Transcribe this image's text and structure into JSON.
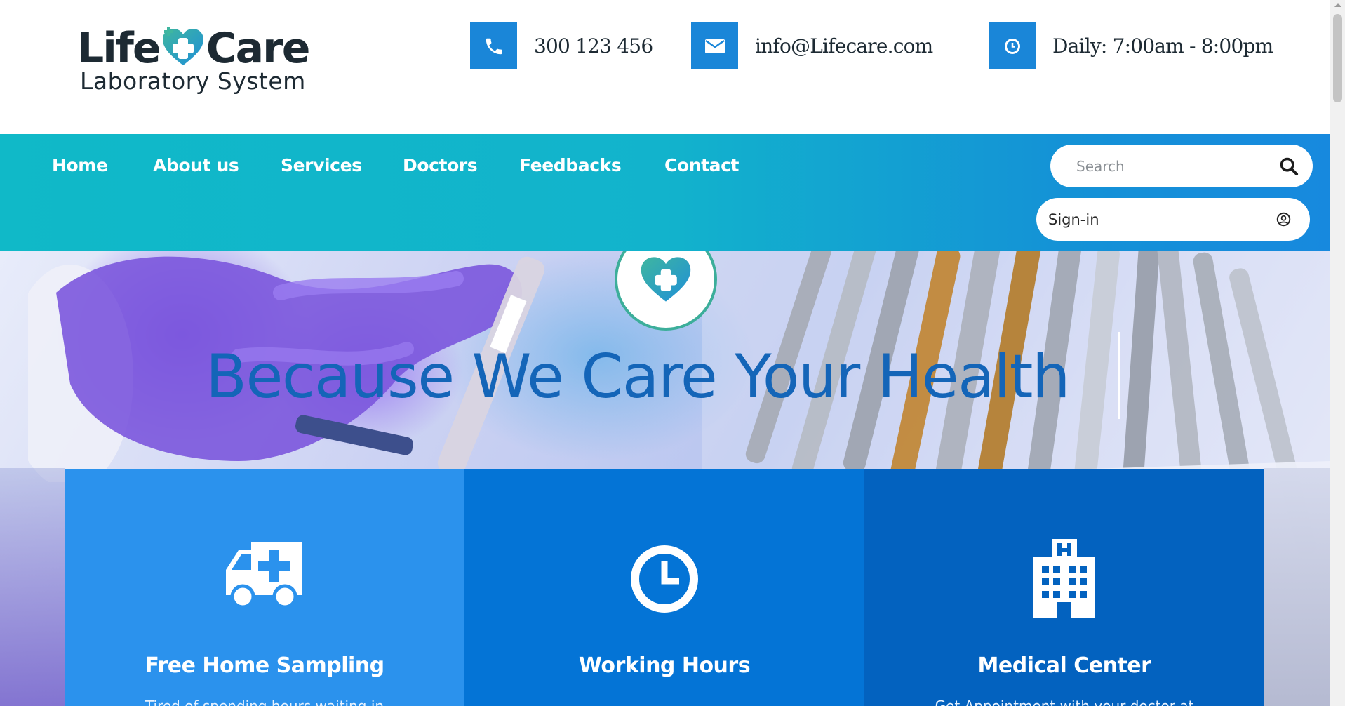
{
  "brand": {
    "name_part1": "Life",
    "name_part2": "Care",
    "tagline": "Laboratory System",
    "colors": {
      "dark": "#1d2a33",
      "teal": "#3cae9a",
      "blue": "#1a86d8"
    }
  },
  "contacts": [
    {
      "icon": "phone-icon",
      "text": "300 123 456"
    },
    {
      "icon": "envelope-icon",
      "text": "info@Lifecare.com"
    },
    {
      "icon": "clock-icon",
      "text": "Daily: 7:00am - 8:00pm"
    }
  ],
  "nav": {
    "items": [
      {
        "label": "Home"
      },
      {
        "label": "About us"
      },
      {
        "label": "Services"
      },
      {
        "label": "Doctors"
      },
      {
        "label": "Feedbacks"
      },
      {
        "label": "Contact"
      }
    ],
    "search": {
      "placeholder": "Search",
      "value": ""
    },
    "signin": {
      "label": "Sign-in"
    },
    "gradient": [
      "#10b9c8",
      "#1789de"
    ]
  },
  "hero": {
    "title": "Because We Care Your Health",
    "title_color": "#1465b8",
    "badge_icon": "heart-plus-icon"
  },
  "features": [
    {
      "icon": "ambulance-icon",
      "title": "Free Home Sampling",
      "description": "Tired of spending hours waiting in",
      "color": "#2b92ed"
    },
    {
      "icon": "clock-icon",
      "title": "Working Hours",
      "description": "",
      "color": "#0474d6"
    },
    {
      "icon": "hospital-icon",
      "title": "Medical Center",
      "description": "Get Appointment with your doctor at",
      "color": "#0362bf"
    }
  ]
}
